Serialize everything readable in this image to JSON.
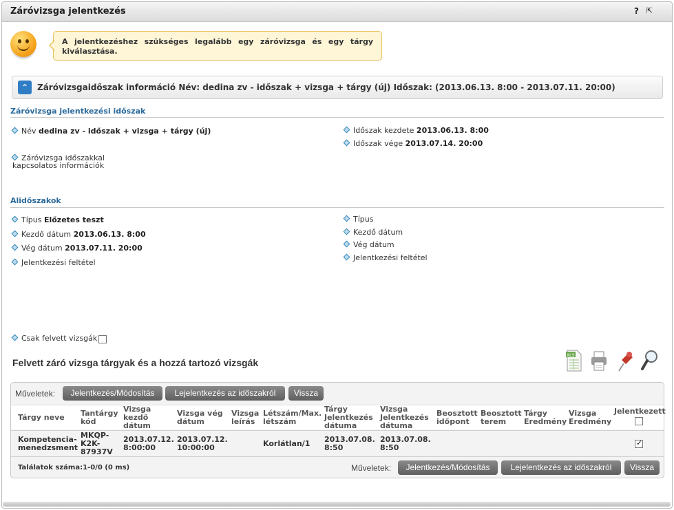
{
  "window": {
    "title": "Záróvizsga jelentkezés",
    "help": "?",
    "popout": "⇱"
  },
  "message": "A jelentkezéshez szükséges legalább egy záróvizsga és egy tárgy kiválasztása.",
  "infobar": {
    "text": "Záróvizsgaidőszak információ Név: dedina zv - időszak + vizsga + tárgy (új) Időszak: (2013.06.13. 8:00 - 2013.07.11. 20:00)"
  },
  "period_section": {
    "title": "Záróvizsga jelentkezési időszak",
    "name_label": "Név",
    "name_value": "dedina zv - időszak + vizsga + tárgy (új)",
    "start_label": "Időszak kezdete",
    "start_value": "2013.06.13. 8:00",
    "end_label": "Időszak vége",
    "end_value": "2013.07.14. 20:00",
    "info_label": "Záróvizsga időszakkal kapcsolatos információk"
  },
  "sub_section": {
    "title": "Alidőszakok",
    "left": {
      "type_label": "Típus",
      "type_value": "Előzetes teszt",
      "start_label": "Kezdő dátum",
      "start_value": "2013.06.13. 8:00",
      "end_label": "Vég dátum",
      "end_value": "2013.07.11. 20:00",
      "cond_label": "Jelentkezési feltétel"
    },
    "right": {
      "type_label": "Típus",
      "start_label": "Kezdő dátum",
      "end_label": "Vég dátum",
      "cond_label": "Jelentkezési feltétel"
    }
  },
  "only_taken": {
    "label": "Csak felvett vizsgák",
    "checked": false
  },
  "list_heading": "Felvett záró vizsga tárgyak és a hozzá tartozó vizsgák",
  "toolbar": {
    "export": "xls-export-icon",
    "print": "print-icon",
    "pin": "pin-icon",
    "search": "search-icon"
  },
  "operations": {
    "label": "Műveletek:",
    "apply": "Jelentkezés/Módosítás",
    "unregister": "Lejelentkezés az időszakról",
    "back": "Vissza"
  },
  "table": {
    "headers": {
      "subject_name": "Tárgy neve",
      "subject_code": "Tantárgy kód",
      "exam_start": "Vizsga kezdő dátum",
      "exam_end": "Vizsga vég dátum",
      "exam_desc": "Vizsga leírás",
      "headcount": "Létszám/Max. létszám",
      "subject_reg": "Tárgy Jelentkezés dátuma",
      "exam_reg": "Vizsga Jelentkezés dátuma",
      "sched_time": "Beosztott időpont",
      "sched_room": "Beosztott terem",
      "subject_result": "Tárgy Eredmény",
      "exam_result": "Vizsga Eredmény",
      "registered": "Jelentkezett"
    },
    "rows": [
      {
        "subject_name": "Kompetencia-menedzsment",
        "subject_code": "MKQP-K2K-87937V",
        "exam_start": "2013.07.12. 8:00:00",
        "exam_end": "2013.07.12. 10:00:00",
        "exam_desc": "",
        "headcount": "Korlátlan/1",
        "subject_reg": "2013.07.08. 8:50",
        "exam_reg": "2013.07.08. 8:50",
        "registered": true
      }
    ]
  },
  "results_count": "Találatok száma:1-0/0 (0 ms)"
}
